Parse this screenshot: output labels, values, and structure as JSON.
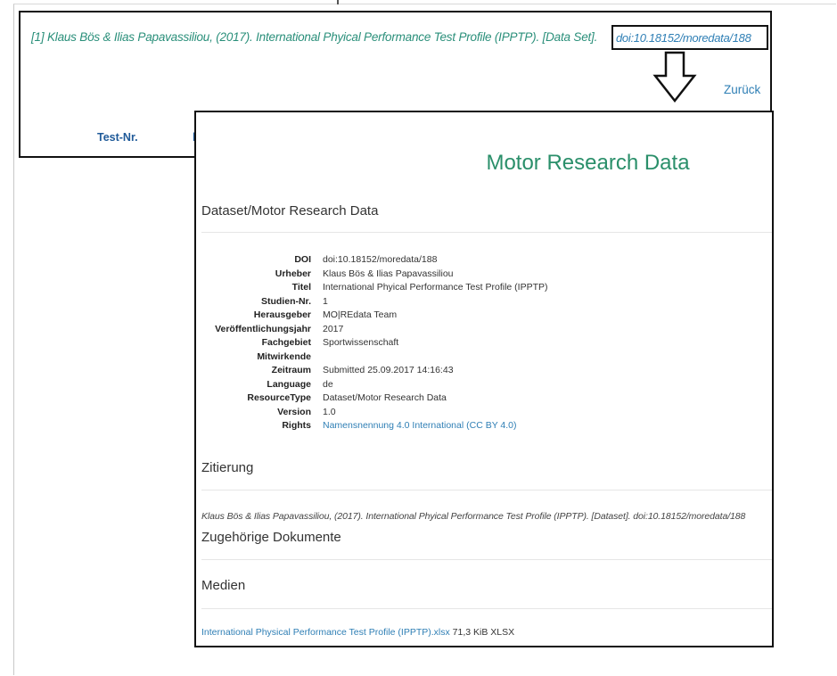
{
  "back_page": {
    "citation": "[1] Klaus Bös & Ilias Papavassiliou, (2017). International Phyical Performance Test Profile (IPPTP). [Data Set].",
    "doi_link": "doi:10.18152/moredata/188",
    "back_label": "Zurück",
    "table_headers": [
      "Test-Nr.",
      "l"
    ]
  },
  "dataset_page": {
    "site_title": "Motor Research Data",
    "breadcrumb": "Dataset/Motor Research Data",
    "metadata": [
      {
        "key": "DOI",
        "value": "doi:10.18152/moredata/188"
      },
      {
        "key": "Urheber",
        "value": "Klaus Bös & Ilias Papavassiliou"
      },
      {
        "key": "Titel",
        "value": "International Phyical Performance Test Profile (IPPTP)"
      },
      {
        "key": "Studien-Nr.",
        "value": "1"
      },
      {
        "key": "Herausgeber",
        "value": "MO|REdata Team"
      },
      {
        "key": "Veröffentlichungsjahr",
        "value": "2017"
      },
      {
        "key": "Fachgebiet",
        "value": "Sportwissenschaft"
      },
      {
        "key": "Mitwirkende",
        "value": ""
      },
      {
        "key": "Zeitraum",
        "value": "Submitted 25.09.2017 14:16:43"
      },
      {
        "key": "Language",
        "value": "de"
      },
      {
        "key": "ResourceType",
        "value": "Dataset/Motor Research Data"
      },
      {
        "key": "Version",
        "value": "1.0"
      },
      {
        "key": "Rights",
        "value": "Namensnennung 4.0 International (CC BY 4.0)"
      }
    ],
    "citation_heading": "Zitierung",
    "citation_text": "Klaus Bös & Ilias Papavassiliou, (2017). International Phyical Performance Test Profile (IPPTP). [Dataset]. doi:10.18152/moredata/188",
    "related_docs_heading": "Zugehörige Dokumente",
    "media_heading": "Medien",
    "media_file": "International Physical Performance Test Profile (IPPTP).xlsx",
    "media_size": "71,3 KiB XLSX"
  },
  "colors": {
    "accent_green": "#2a8f6a",
    "link_blue": "#2f7fb5",
    "header_blue": "#1f5a99"
  }
}
